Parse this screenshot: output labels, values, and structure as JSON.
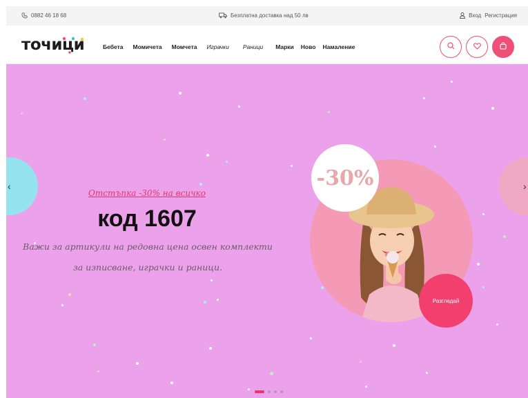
{
  "topbar": {
    "phone": "0882 46 18 68",
    "shipping": "Безплатна доставка над 50 лв",
    "login": "Вход",
    "register": "Регистрация"
  },
  "header": {
    "logo_text": "точици",
    "nav": [
      "Бебета",
      "Момичета",
      "Момчета",
      "Играчки",
      "Раници",
      "Марки",
      "Ново",
      "Намаление"
    ],
    "icons": [
      "search-icon",
      "heart-icon",
      "bag-icon"
    ],
    "accent_color": "#ef4f78"
  },
  "hero": {
    "background": "#eca2ea",
    "promo_link": "Отстъпка -30% на всичко",
    "code": "код 1607",
    "description_line1": "Важи за артикули на редовна цена освен комплекти",
    "description_line2": "за изписване, играчки и раници.",
    "discount_badge": "-30%",
    "browse_button": "Разгледай",
    "slide_count": 4,
    "active_slide": 1
  }
}
